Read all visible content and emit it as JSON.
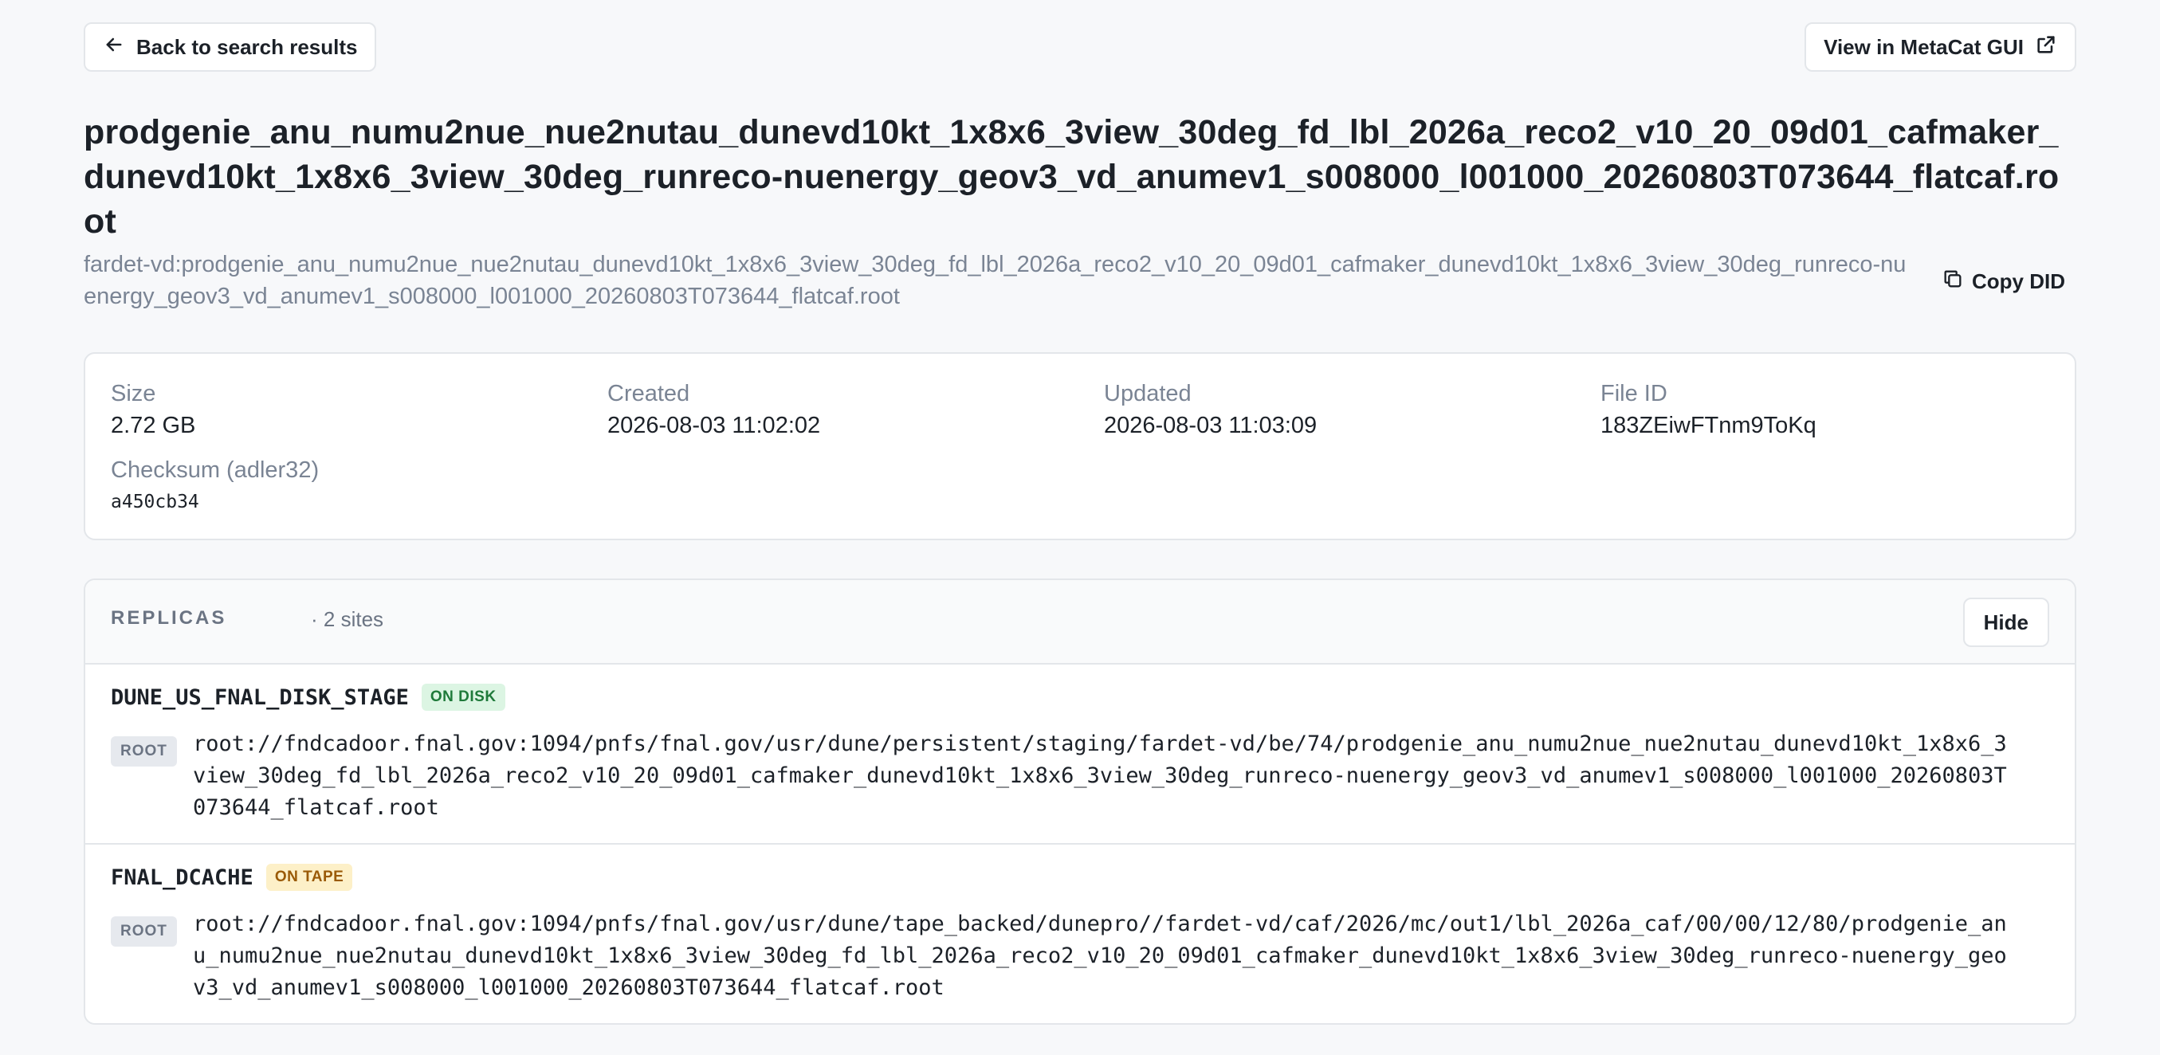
{
  "nav": {
    "back_label": "Back to search results",
    "external_label": "View in MetaCat GUI"
  },
  "file": {
    "name": "prodgenie_anu_numu2nue_nue2nutau_dunevd10kt_1x8x6_3view_30deg_fd_lbl_2026a_reco2_v10_20_09d01_cafmaker_dunevd10kt_1x8x6_3view_30deg_runreco-nuenergy_geov3_vd_anumev1_s008000_l001000_20260803T073644_flatcaf.root",
    "did": "fardet-vd:prodgenie_anu_numu2nue_nue2nutau_dunevd10kt_1x8x6_3view_30deg_fd_lbl_2026a_reco2_v10_20_09d01_cafmaker_dunevd10kt_1x8x6_3view_30deg_runreco-nuenergy_geov3_vd_anumev1_s008000_l001000_20260803T073644_flatcaf.root",
    "copy_label": "Copy DID"
  },
  "meta": {
    "size_label": "Size",
    "size_value": "2.72 GB",
    "created_label": "Created",
    "created_value": "2026-08-03 11:02:02",
    "updated_label": "Updated",
    "updated_value": "2026-08-03 11:03:09",
    "fileid_label": "File ID",
    "fileid_value": "183ZEiwFTnm9ToKq",
    "checksum_label": "Checksum (adler32)",
    "checksum_value": "a450cb34"
  },
  "replicas": {
    "title": "REPLICAS",
    "count": "· 2 sites",
    "hide_label": "Hide",
    "items": [
      {
        "site": "DUNE_US_FNAL_DISK_STAGE",
        "status": "ON DISK",
        "protocol": "ROOT",
        "path": "root://fndcadoor.fnal.gov:1094/pnfs/fnal.gov/usr/dune/persistent/staging/fardet-vd/be/74/prodgenie_anu_numu2nue_nue2nutau_dunevd10kt_1x8x6_3view_30deg_fd_lbl_2026a_reco2_v10_20_09d01_cafmaker_dunevd10kt_1x8x6_3view_30deg_runreco-nuenergy_geov3_vd_anumev1_s008000_l001000_20260803T073644_flatcaf.root"
      },
      {
        "site": "FNAL_DCACHE",
        "status": "ON TAPE",
        "protocol": "ROOT",
        "path": "root://fndcadoor.fnal.gov:1094/pnfs/fnal.gov/usr/dune/tape_backed/dunepro//fardet-vd/caf/2026/mc/out1/lbl_2026a_caf/00/00/12/80/prodgenie_anu_numu2nue_nue2nutau_dunevd10kt_1x8x6_3view_30deg_fd_lbl_2026a_reco2_v10_20_09d01_cafmaker_dunevd10kt_1x8x6_3view_30deg_runreco-nuenergy_geov3_vd_anumev1_s008000_l001000_20260803T073644_flatcaf.root"
      }
    ]
  },
  "icons": {
    "back": "arrow-left-icon",
    "external": "external-link-icon",
    "copy": "copy-icon"
  }
}
